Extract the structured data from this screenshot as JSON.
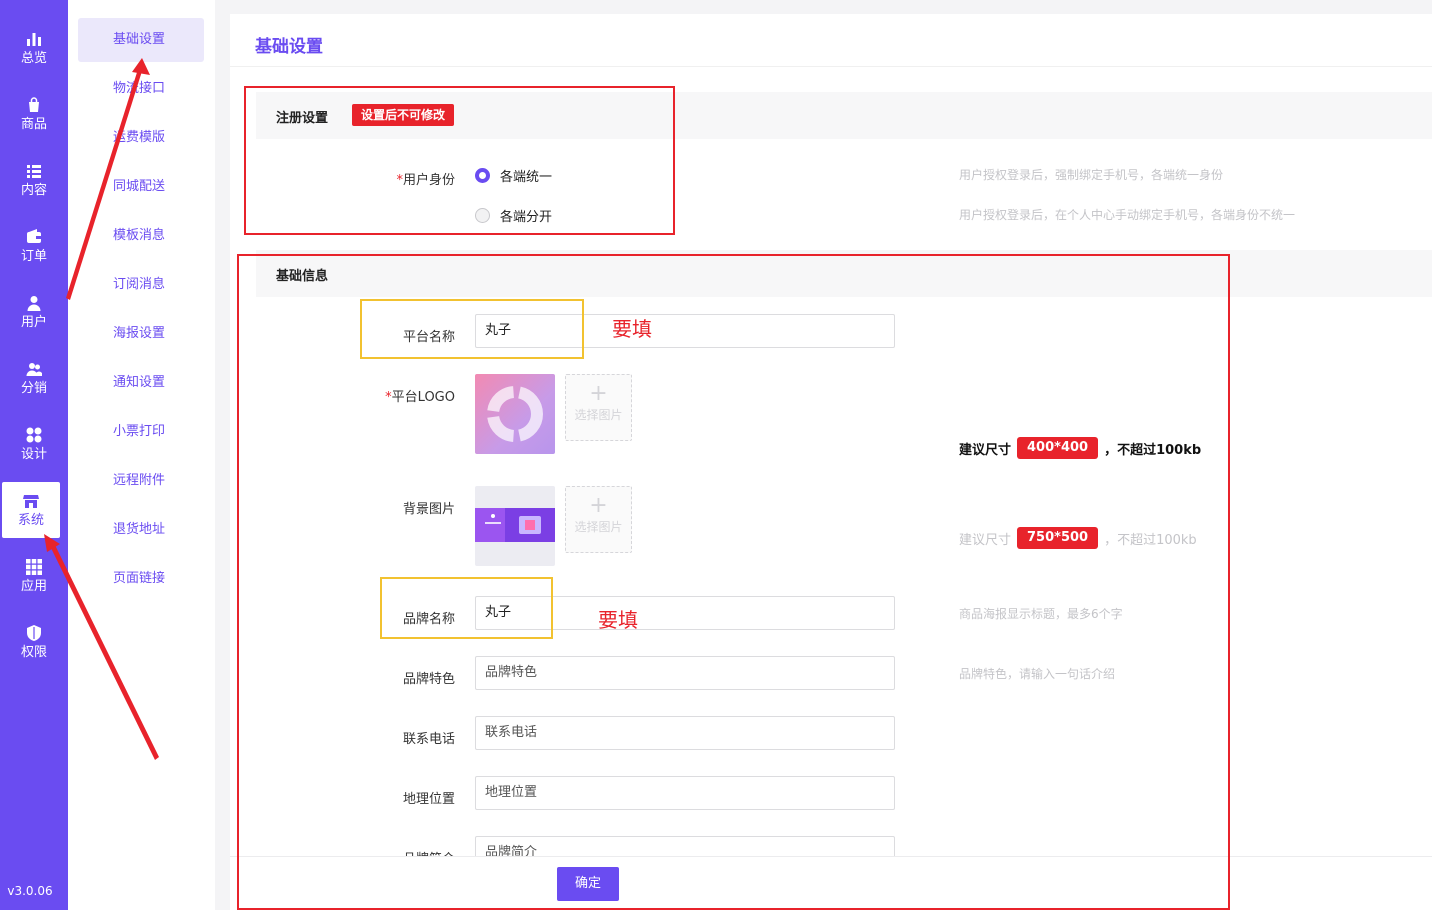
{
  "colors": {
    "brand": "#6a4cf1",
    "danger": "#e8232b",
    "highlight": "#f2c230"
  },
  "rail": {
    "items": [
      {
        "label": "总览",
        "icon": "chart-bar-icon"
      },
      {
        "label": "商品",
        "icon": "shopping-bag-icon"
      },
      {
        "label": "内容",
        "icon": "list-icon"
      },
      {
        "label": "订单",
        "icon": "wallet-icon"
      },
      {
        "label": "用户",
        "icon": "user-icon"
      },
      {
        "label": "分销",
        "icon": "users-icon"
      },
      {
        "label": "设计",
        "icon": "palette-icon"
      },
      {
        "label": "系统",
        "icon": "store-icon",
        "active": true
      },
      {
        "label": "应用",
        "icon": "grid-icon"
      },
      {
        "label": "权限",
        "icon": "shield-icon"
      }
    ],
    "version": "v3.0.06"
  },
  "subnav": {
    "items": [
      "基础设置",
      "物流接口",
      "运费模版",
      "同城配送",
      "模板消息",
      "订阅消息",
      "海报设置",
      "通知设置",
      "小票打印",
      "远程附件",
      "退货地址",
      "页面链接"
    ],
    "active_index": 0
  },
  "page": {
    "title": "基础设置"
  },
  "registration": {
    "title": "注册设置",
    "badge": "设置后不可修改",
    "identity_label": "用户身份",
    "options": [
      {
        "label": "各端统一",
        "checked": true,
        "hint": "用户授权登录后，强制绑定手机号，各端统一身份"
      },
      {
        "label": "各端分开",
        "checked": false,
        "hint": "用户授权登录后，在个人中心手动绑定手机号，各端身份不统一"
      }
    ]
  },
  "basic": {
    "title": "基础信息",
    "platform_name": {
      "label": "平台名称",
      "value": "丸子"
    },
    "logo": {
      "label": "平台LOGO",
      "pick": "选择图片",
      "tip_prefix": "建议尺寸",
      "tip_size": "400*400",
      "tip_suffix": "，不超过100kb"
    },
    "background": {
      "label": "背景图片",
      "pick": "选择图片",
      "tip_prefix": "建议尺寸",
      "tip_size": "750*500",
      "tip_suffix": "，不超过100kb"
    },
    "brand_name": {
      "label": "品牌名称",
      "value": "丸子",
      "hint": "商品海报显示标题，最多6个字"
    },
    "brand_feature": {
      "label": "品牌特色",
      "placeholder": "品牌特色",
      "hint": "品牌特色，请输入一句话介绍"
    },
    "phone": {
      "label": "联系电话",
      "placeholder": "联系电话"
    },
    "location": {
      "label": "地理位置",
      "placeholder": "地理位置"
    },
    "intro": {
      "label": "品牌简介",
      "placeholder": "品牌简介"
    }
  },
  "confirm_button": "确定",
  "annotations": {
    "must_fill_1": "要填",
    "must_fill_2": "要填"
  }
}
